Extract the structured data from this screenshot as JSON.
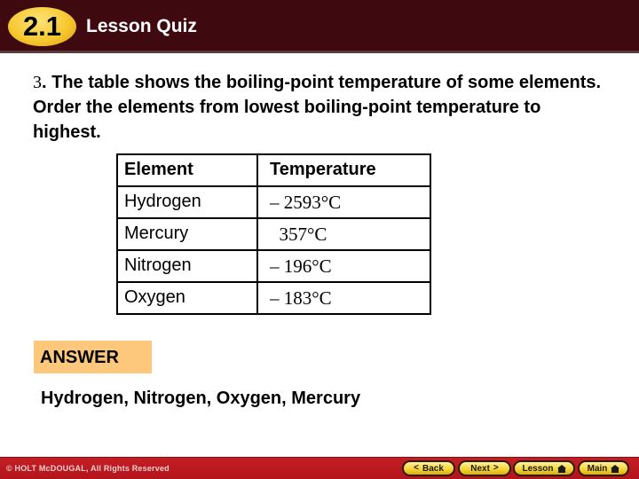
{
  "header": {
    "section_number": "2.1",
    "title": "Lesson Quiz"
  },
  "question": {
    "number": "3",
    "text": ". The table shows the boiling-point temperature of some elements. Order the elements from lowest boiling-point temperature to highest."
  },
  "table": {
    "headers": {
      "element": "Element",
      "temperature": "Temperature"
    },
    "rows": [
      {
        "element": "Hydrogen",
        "temperature": "– 2593°C"
      },
      {
        "element": "Mercury",
        "temperature": "  357°C"
      },
      {
        "element": "Nitrogen",
        "temperature": "– 196°C"
      },
      {
        "element": "Oxygen",
        "temperature": "– 183°C"
      }
    ]
  },
  "answer": {
    "label": "ANSWER",
    "text": "Hydrogen, Nitrogen, Oxygen, Mercury"
  },
  "footer": {
    "copyright": "© HOLT McDOUGAL, All Rights Reserved",
    "buttons": {
      "back": "Back",
      "next": "Next",
      "lesson": "Lesson",
      "main": "Main"
    }
  },
  "colors": {
    "header_bg": "#3f0a0f",
    "badge": "#f7c830",
    "answer_box": "#fdc77c",
    "footer_bg": "#c41e25"
  }
}
